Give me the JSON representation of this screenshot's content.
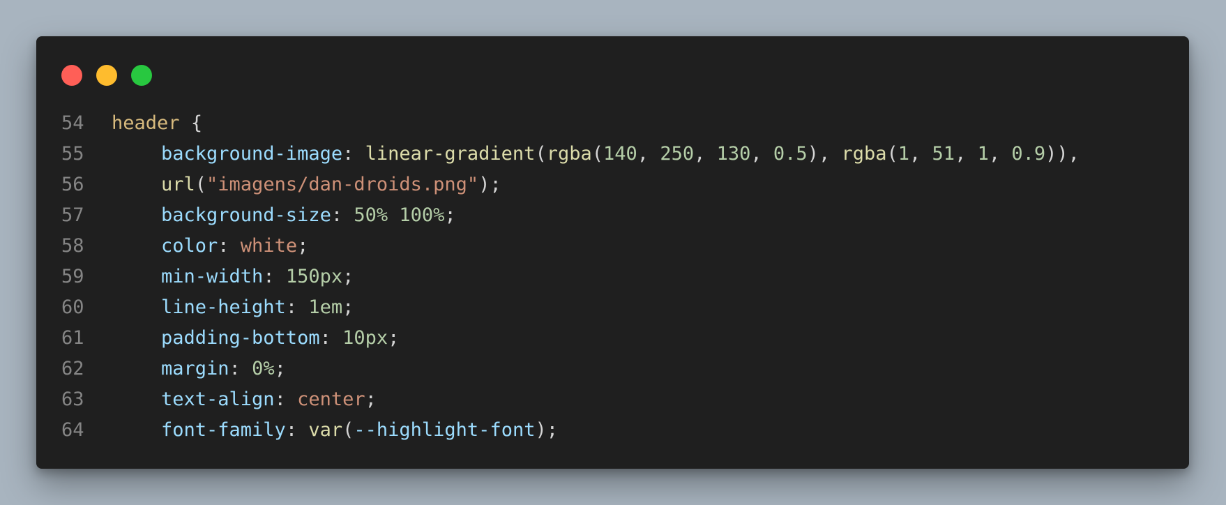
{
  "window": {
    "controls": [
      {
        "name": "close",
        "color": "#ff5f57"
      },
      {
        "name": "minimize",
        "color": "#febc2e"
      },
      {
        "name": "maximize",
        "color": "#28c840"
      }
    ]
  },
  "colors": {
    "background": "#a8b4bf",
    "editor_background": "#1f1f1f",
    "line_number": "#858585",
    "selector": "#d7ba7d",
    "property": "#9cdcfe",
    "function": "#dcdcaa",
    "number": "#b5cea8",
    "string": "#ce9178",
    "punctuation": "#d4d4d4"
  },
  "code": {
    "lines": [
      {
        "number": "54",
        "tokens": {
          "selector": "header",
          "space": " ",
          "brace": "{"
        }
      },
      {
        "number": "55",
        "tokens": {
          "prop": "background-image",
          "colon": ": ",
          "f1": "linear-gradient",
          "p1": "(",
          "f2": "rgba",
          "p2": "(",
          "n1": "140",
          "c1": ", ",
          "n2": "250",
          "c2": ", ",
          "n3": "130",
          "c3": ", ",
          "n4": "0.5",
          "p3": "), ",
          "f3": "rgba",
          "p4": "(",
          "n5": "1",
          "c4": ", ",
          "n6": "51",
          "c5": ", ",
          "n7": "1",
          "c6": ", ",
          "n8": "0.9",
          "p5": ")),"
        }
      },
      {
        "number": "56",
        "tokens": {
          "fn": "url",
          "p1": "(",
          "str": "\"imagens/dan-droids.png\"",
          "p2": ");"
        }
      },
      {
        "number": "57",
        "tokens": {
          "prop": "background-size",
          "colon": ": ",
          "n1": "50%",
          "sp": " ",
          "n2": "100%",
          "semi": ";"
        }
      },
      {
        "number": "58",
        "tokens": {
          "prop": "color",
          "colon": ": ",
          "val": "white",
          "semi": ";"
        }
      },
      {
        "number": "59",
        "tokens": {
          "prop": "min-width",
          "colon": ": ",
          "num": "150px",
          "semi": ";"
        }
      },
      {
        "number": "60",
        "tokens": {
          "prop": "line-height",
          "colon": ": ",
          "num": "1em",
          "semi": ";"
        }
      },
      {
        "number": "61",
        "tokens": {
          "prop": "padding-bottom",
          "colon": ": ",
          "num": "10px",
          "semi": ";"
        }
      },
      {
        "number": "62",
        "tokens": {
          "prop": "margin",
          "colon": ": ",
          "num": "0%",
          "semi": ";"
        }
      },
      {
        "number": "63",
        "tokens": {
          "prop": "text-align",
          "colon": ": ",
          "val": "center",
          "semi": ";"
        }
      },
      {
        "number": "64",
        "tokens": {
          "prop": "font-family",
          "colon": ": ",
          "fn": "var",
          "p1": "(",
          "var": "--highlight-font",
          "p2": ");"
        }
      }
    ]
  }
}
